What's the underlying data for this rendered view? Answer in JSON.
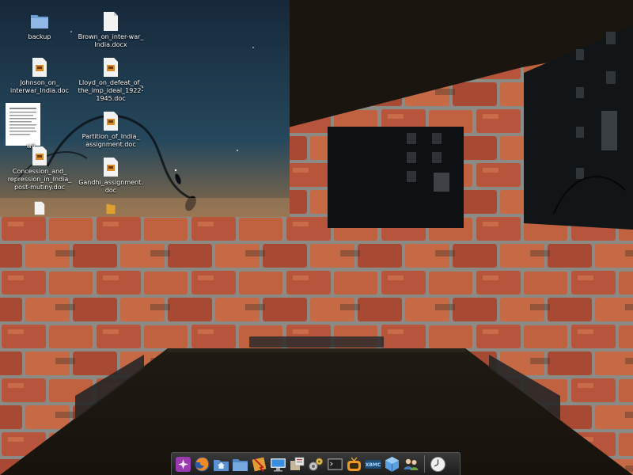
{
  "desktop": {
    "icons": [
      {
        "label": "backup",
        "icon": "folder-icon"
      },
      {
        "label": "Brown_on_inter-war_\nIndia.docx",
        "icon": "document-icon"
      },
      {
        "label": "Johnson_on_\ninterwar_India.doc",
        "icon": "document-icon"
      },
      {
        "label": "Lloyd_on_defeat_of_\nthe_imp_ideal_1922-\n1945.doc",
        "icon": "document-icon"
      },
      {
        "label": "Partition_of_India_\nassignment.doc",
        "icon": "document-icon"
      },
      {
        "label": "Concession_and_\nrepression_in_India_\npost-mutiny.doc",
        "icon": "document-icon"
      },
      {
        "label": "Gandhi_assignment.\ndoc",
        "icon": "document-icon"
      },
      {
        "label": "wii",
        "icon": "document-thumbnail-icon"
      }
    ]
  },
  "dock": {
    "items": [
      {
        "name": "kde-menu-icon",
        "color": "#c85ad8"
      },
      {
        "name": "firefox-icon",
        "color": "#f08a24"
      },
      {
        "name": "home-folder-icon",
        "color": "#5a90d0"
      },
      {
        "name": "folder-icon",
        "color": "#4f86c6"
      },
      {
        "name": "package-installer-icon",
        "color": "#e0a030"
      },
      {
        "name": "monitor-icon",
        "color": "#4aa0e8"
      },
      {
        "name": "package-manager-icon",
        "color": "#b0b0b0"
      },
      {
        "name": "system-settings-icon",
        "color": "#c0c0c0"
      },
      {
        "name": "terminal-icon",
        "color": "#303030"
      },
      {
        "name": "tv-icon",
        "color": "#f09a20"
      },
      {
        "name": "xbmc-icon",
        "color": "#2a6a9a"
      },
      {
        "name": "virtualbox-icon",
        "color": "#4a90d0"
      },
      {
        "name": "users-icon",
        "color": "#6aa0d8"
      },
      {
        "name": "clock-icon",
        "color": "#e0e0e0"
      }
    ]
  },
  "colors": {
    "brick": "#b5543a",
    "mortar": "#8a8780",
    "floor": "#1b170f",
    "window_sky": "#1f3a4e"
  }
}
